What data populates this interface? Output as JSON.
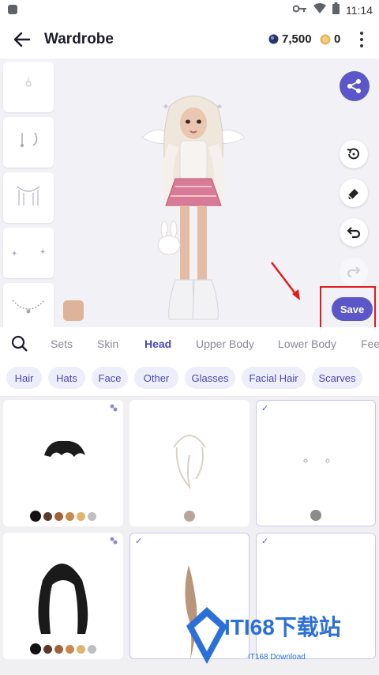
{
  "status_bar": {
    "time": "11:14"
  },
  "app_bar": {
    "title": "Wardrobe",
    "gems": "7,500",
    "coins": "0"
  },
  "preview": {
    "save_label": "Save",
    "skin_color": "#ddb49a"
  },
  "tabs": [
    {
      "label": "Sets",
      "active": false
    },
    {
      "label": "Skin",
      "active": false
    },
    {
      "label": "Head",
      "active": true
    },
    {
      "label": "Upper Body",
      "active": false
    },
    {
      "label": "Lower Body",
      "active": false
    },
    {
      "label": "Fee",
      "active": false
    }
  ],
  "chips": [
    "Hair",
    "Hats",
    "Face",
    "Other",
    "Glasses",
    "Facial Hair",
    "Scarves"
  ],
  "grid": {
    "row1": [
      {
        "item": "short-black-hair",
        "selected": false,
        "colors": [
          "#111111",
          "#5a3a2a",
          "#a0623a",
          "#c8894f",
          "#e0b46c",
          "#bfbfbf"
        ]
      },
      {
        "item": "blonde-bangs",
        "selected": false,
        "colors": [
          "#b8a69a"
        ]
      },
      {
        "item": "ear-studs",
        "selected": true,
        "colors": [
          "#8c8c8c"
        ]
      }
    ],
    "row2": [
      {
        "item": "long-wavy-black-hair",
        "selected": false,
        "colors": [
          "#111111",
          "#5a3a2a",
          "#a0623a",
          "#c8894f",
          "#e0b46c",
          "#bfbfbf"
        ]
      },
      {
        "item": "ponytail",
        "selected": true,
        "colors": []
      },
      {
        "item": "empty",
        "selected": true,
        "colors": []
      }
    ]
  },
  "colors": {
    "accent": "#5b57c9",
    "highlight": "#e21b1b"
  },
  "watermark": {
    "text": "ITI68下载站",
    "sub": "IT168 Download"
  }
}
